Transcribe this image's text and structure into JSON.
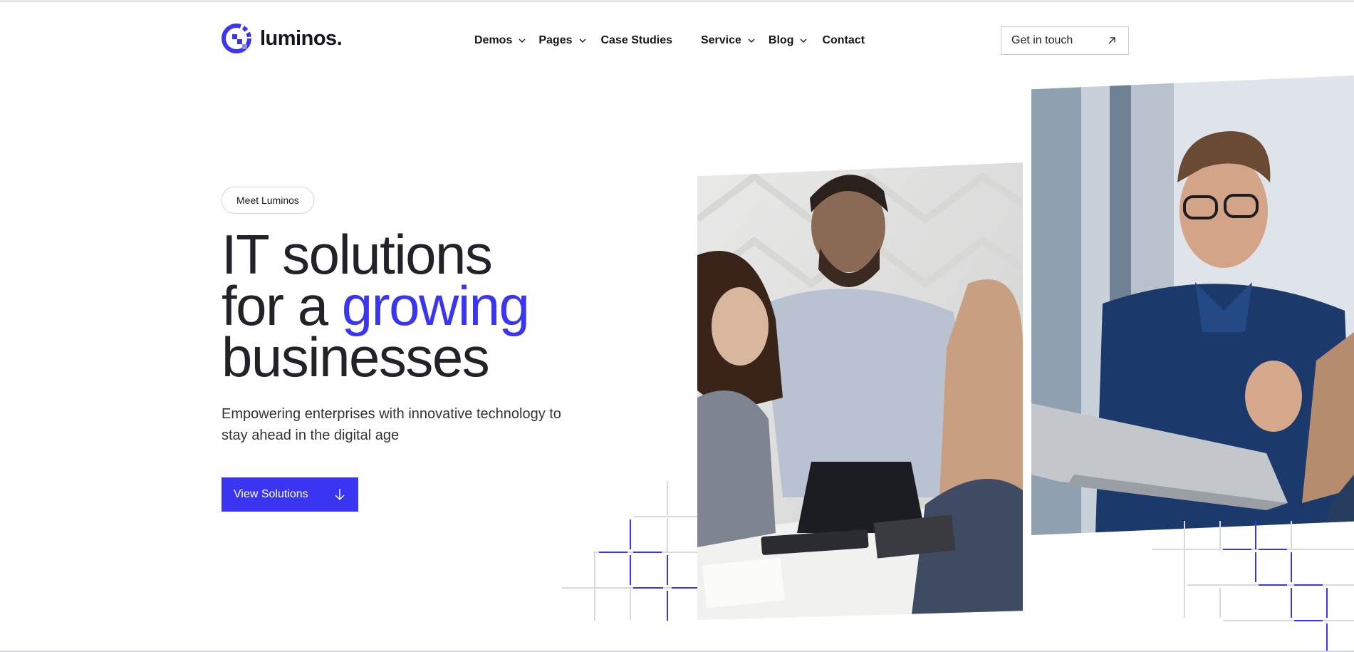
{
  "brand": {
    "name": "luminos.",
    "accent_color": "#3a35f0",
    "logo_icon": "luminos-q-icon"
  },
  "nav": {
    "items": [
      {
        "label": "Demos",
        "has_dropdown": true
      },
      {
        "label": "Pages",
        "has_dropdown": true
      },
      {
        "label": "Case Studies",
        "has_dropdown": false
      },
      {
        "label": "Service",
        "has_dropdown": true
      },
      {
        "label": "Blog",
        "has_dropdown": true
      },
      {
        "label": "Contact",
        "has_dropdown": false
      }
    ],
    "cta": {
      "label": "Get in touch",
      "icon": "arrow-up-right-icon"
    }
  },
  "hero": {
    "badge": "Meet Luminos",
    "headline": {
      "line1": "IT solutions",
      "line2_prefix": "for a ",
      "line2_accent": "growing",
      "line3": "businesses"
    },
    "subtext": "Empowering enterprises with innovative technology to stay ahead in the digital age",
    "button": {
      "label": "View Solutions",
      "icon": "arrow-down-icon"
    },
    "images": [
      {
        "name": "team-meeting-photo"
      },
      {
        "name": "man-with-laptop-photo"
      }
    ]
  }
}
